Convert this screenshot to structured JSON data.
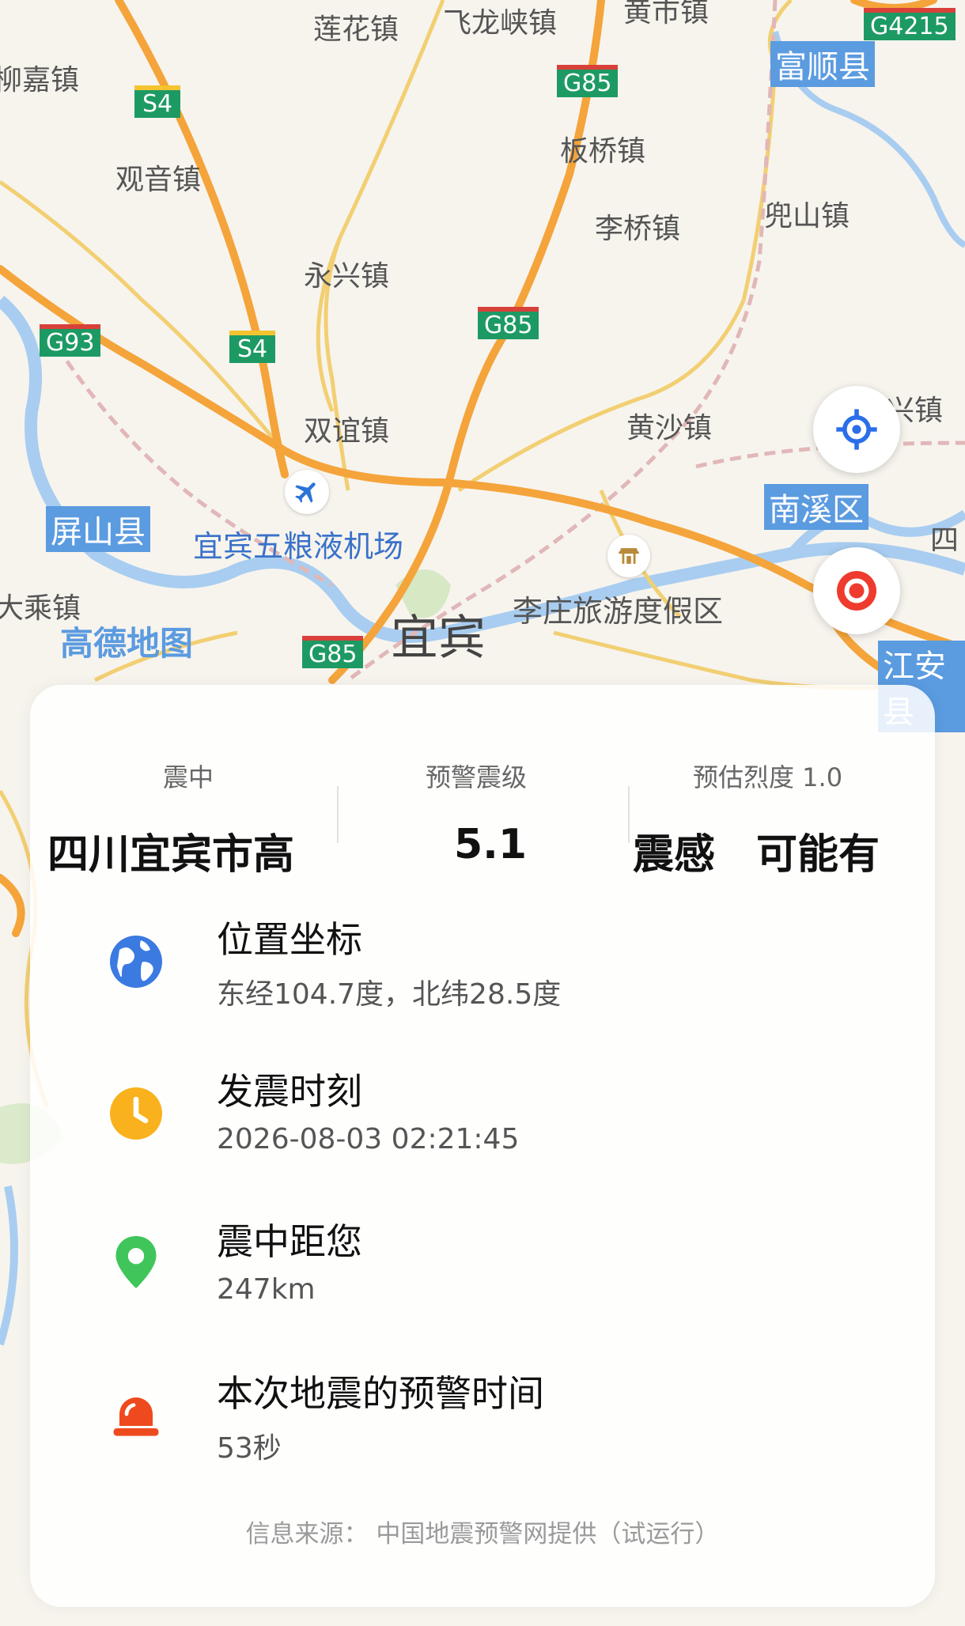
{
  "map": {
    "logo": "高德地图",
    "city": "宜宾",
    "places": [
      "莲花镇",
      "飞龙峡镇",
      "黄市镇",
      "柳嘉镇",
      "观音镇",
      "板桥镇",
      "李桥镇",
      "兜山镇",
      "永兴镇",
      "双谊镇",
      "黄沙镇",
      "兴镇",
      "宜宾五粮液机场",
      "李庄旅游度假区",
      "大乘镇"
    ],
    "counties": [
      "富顺县",
      "屏山县",
      "南溪区",
      "江安县",
      "四"
    ],
    "highways": [
      "S4",
      "G85",
      "G4215",
      "G93"
    ],
    "colors": {
      "land": "#f7f4ee",
      "highway": "#f4a43a",
      "road": "#f2cf72",
      "water": "#a8cdf0"
    }
  },
  "controls": {
    "locate": "locate-icon",
    "epicenter": "epicenter-marker-icon"
  },
  "card": {
    "stats": [
      {
        "label": "震中",
        "value": "四川宜宾市高"
      },
      {
        "label": "预警震级",
        "value": "5.1"
      },
      {
        "label": "预估烈度 1.0",
        "value": "震感　可能有"
      }
    ],
    "rows": [
      {
        "title": "位置坐标",
        "sub": "东经104.7度，北纬28.5度",
        "icon": "globe-icon",
        "color": "#3b7ae0"
      },
      {
        "title": "发震时刻",
        "sub": "2026-08-03 02:21:45",
        "icon": "clock-icon",
        "color": "#f9b21d"
      },
      {
        "title": "震中距您",
        "sub": "247km",
        "icon": "location-pin-icon",
        "color": "#3fc55a"
      },
      {
        "title": "本次地震的预警时间",
        "sub": "53秒",
        "icon": "alarm-icon",
        "color": "#ee4a1d"
      }
    ],
    "footer": "信息来源：  中国地震预警网提供（试运行）"
  }
}
